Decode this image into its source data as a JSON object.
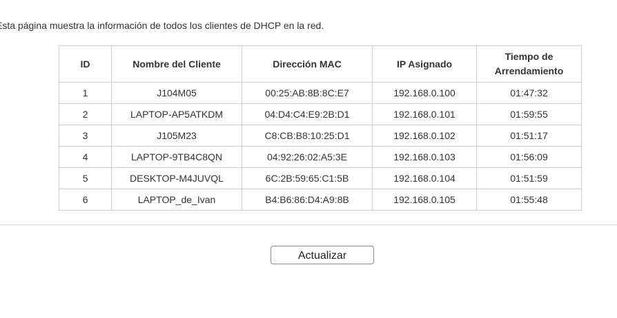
{
  "intro_text": "Esta página muestra la información de todos los clientes de DHCP en la red.",
  "table": {
    "headers": {
      "id": "ID",
      "name": "Nombre del Cliente",
      "mac": "Dirección MAC",
      "ip": "IP Asignado",
      "lease_line1": "Tiempo de",
      "lease_line2": "Arrendamiento"
    },
    "rows": [
      {
        "id": "1",
        "name": "J104M05",
        "mac": "00:25:AB:8B:8C:E7",
        "ip": "192.168.0.100",
        "lease": "01:47:32"
      },
      {
        "id": "2",
        "name": "LAPTOP-AP5ATKDM",
        "mac": "04:D4:C4:E9:2B:D1",
        "ip": "192.168.0.101",
        "lease": "01:59:55"
      },
      {
        "id": "3",
        "name": "J105M23",
        "mac": "C8:CB:B8:10:25:D1",
        "ip": "192.168.0.102",
        "lease": "01:51:17"
      },
      {
        "id": "4",
        "name": "LAPTOP-9TB4C8QN",
        "mac": "04:92:26:02:A5:3E",
        "ip": "192.168.0.103",
        "lease": "01:56:09"
      },
      {
        "id": "5",
        "name": "DESKTOP-M4JUVQL",
        "mac": "6C:2B:59:65:C1:5B",
        "ip": "192.168.0.104",
        "lease": "01:51:59"
      },
      {
        "id": "6",
        "name": "LAPTOP_de_Ivan",
        "mac": "B4:B6:86:D4:A9:8B",
        "ip": "192.168.0.105",
        "lease": "01:55:48"
      }
    ]
  },
  "refresh_button_label": "Actualizar"
}
